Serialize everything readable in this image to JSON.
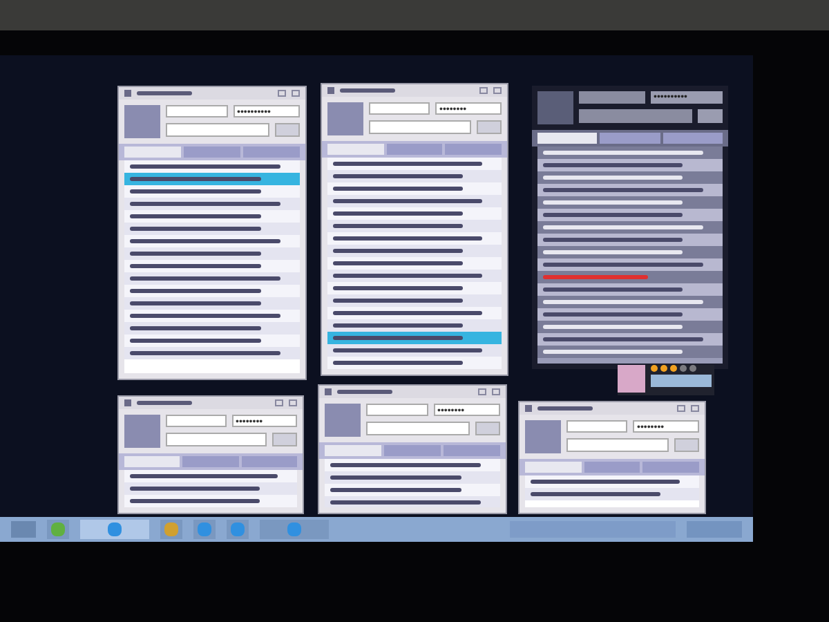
{
  "windows": [
    {
      "kind": "chat",
      "password": "••••••••••",
      "rows": [
        {
          "selected": false
        },
        {
          "selected": true
        },
        {
          "selected": false
        },
        {
          "selected": false
        },
        {
          "selected": false
        },
        {
          "selected": false
        },
        {
          "selected": false
        },
        {
          "selected": false
        },
        {
          "selected": false
        },
        {
          "selected": false
        },
        {
          "selected": false
        },
        {
          "selected": false
        },
        {
          "selected": false
        },
        {
          "selected": false
        },
        {
          "selected": false
        },
        {
          "selected": false
        }
      ]
    },
    {
      "kind": "chat",
      "password": "••••••••",
      "rows": [
        {
          "selected": false
        },
        {
          "selected": false
        },
        {
          "selected": false
        },
        {
          "selected": false
        },
        {
          "selected": false
        },
        {
          "selected": false
        },
        {
          "selected": false
        },
        {
          "selected": false
        },
        {
          "selected": false
        },
        {
          "selected": false
        },
        {
          "selected": false
        },
        {
          "selected": false
        },
        {
          "selected": false
        },
        {
          "selected": false
        },
        {
          "selected": true
        },
        {
          "selected": false
        },
        {
          "selected": false
        }
      ]
    },
    {
      "kind": "dark",
      "password": "••••••••••",
      "rows": [
        {
          "selected": false
        },
        {
          "selected": false
        },
        {
          "selected": false
        },
        {
          "selected": false
        },
        {
          "selected": false
        },
        {
          "selected": false
        },
        {
          "selected": false
        },
        {
          "selected": false
        },
        {
          "selected": false
        },
        {
          "selected": false
        },
        {
          "selected": false,
          "alert": true
        },
        {
          "selected": false
        },
        {
          "selected": false
        },
        {
          "selected": false
        },
        {
          "selected": false
        },
        {
          "selected": false
        },
        {
          "selected": false
        }
      ]
    },
    {
      "kind": "chat",
      "password": "••••••••",
      "rows": [
        {
          "selected": false
        },
        {
          "selected": false
        },
        {
          "selected": false
        }
      ]
    },
    {
      "kind": "chat",
      "password": "••••••••",
      "rows": [
        {
          "selected": false
        },
        {
          "selected": false
        },
        {
          "selected": false
        },
        {
          "selected": false
        }
      ]
    },
    {
      "kind": "chat",
      "password": "••••••••",
      "rows": [
        {
          "selected": false
        },
        {
          "selected": false
        }
      ]
    }
  ],
  "profile": {
    "stars": 3
  },
  "taskbar": {
    "items": [
      {
        "selected": false
      },
      {
        "selected": true
      },
      {
        "selected": false
      },
      {
        "selected": false
      },
      {
        "selected": false
      },
      {
        "selected": false
      }
    ]
  }
}
